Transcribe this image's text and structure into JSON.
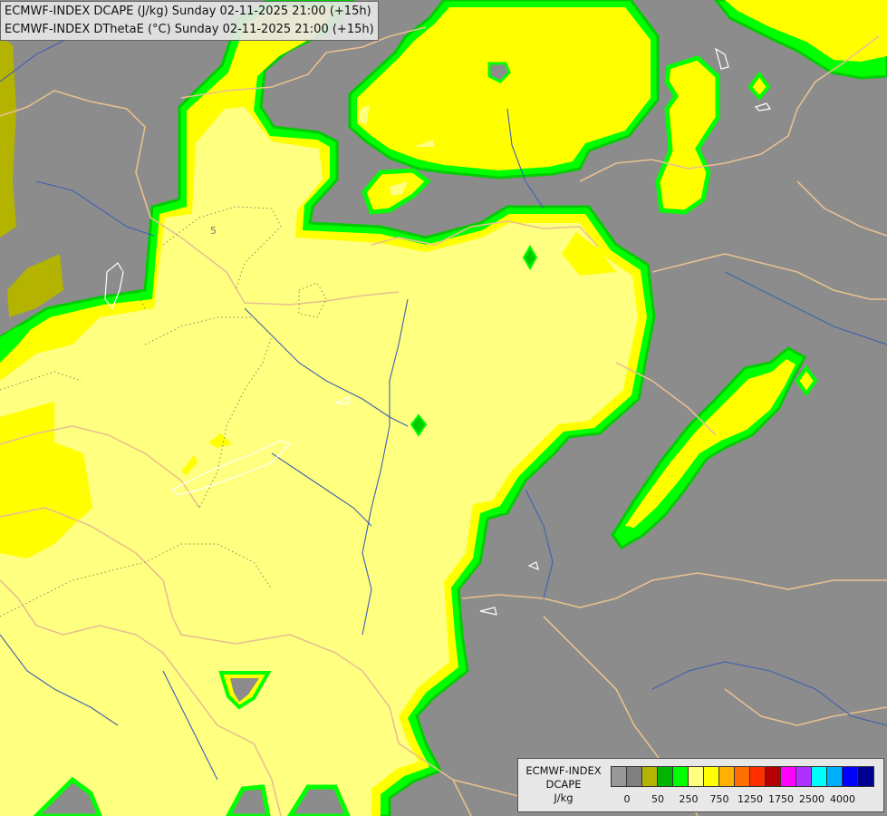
{
  "header": {
    "line1": "ECMWF-INDEX DCAPE (J/kg) Sunday 02-11-2025 21:00 (+15h)",
    "line2": "ECMWF-INDEX DThetaE (°C) Sunday 02-11-2025 21:00 (+15h)"
  },
  "map": {
    "contour_label": "5",
    "colors": {
      "background": "#8c8c8c",
      "pale_yellow": "#ffff80",
      "yellow": "#ffff00",
      "green": "#00cc00",
      "bright_green": "#00ff00",
      "olive": "#b4b400",
      "border": "#e8c090",
      "river": "#4060b0"
    }
  },
  "legend": {
    "title_line1": "ECMWF-INDEX",
    "title_line2": "DCAPE",
    "title_line3": "J/kg",
    "colors": [
      "#999999",
      "#808080",
      "#b4b400",
      "#00b400",
      "#00ff00",
      "#ffff80",
      "#ffff00",
      "#ffb000",
      "#ff7000",
      "#ff3000",
      "#b40000",
      "#ff00ff",
      "#b030ff",
      "#00ffff",
      "#00b0ff",
      "#0000ff",
      "#000090"
    ],
    "tick_labels": [
      "0",
      "50",
      "250",
      "750",
      "1250",
      "1750",
      "2500",
      "4000"
    ]
  }
}
